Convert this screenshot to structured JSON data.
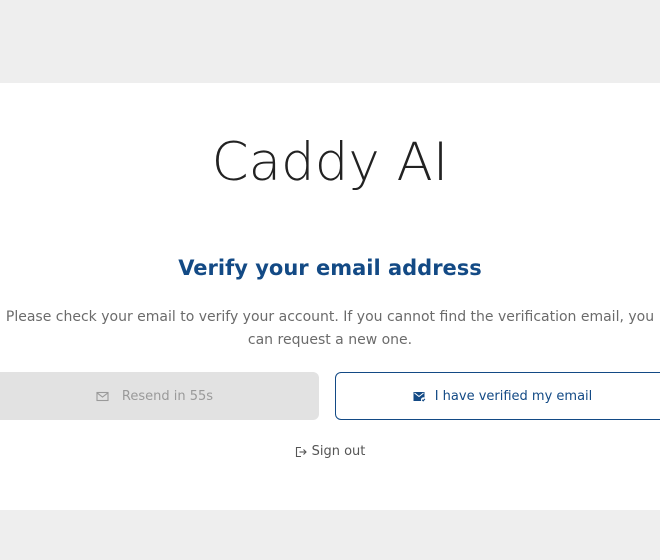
{
  "app": {
    "brand": "Caddy AI"
  },
  "verify": {
    "title": "Verify your email address",
    "message": "Please check your email to verify your account. If you cannot find the verification email, you can request a new one."
  },
  "actions": {
    "resend": {
      "label": "Resend in 55s",
      "icon": "mail-icon",
      "disabled": true
    },
    "verified": {
      "label": "I have verified my email",
      "icon": "mail-check-icon"
    },
    "signout": {
      "label": "Sign out",
      "icon": "sign-out-icon"
    }
  },
  "colors": {
    "accent": "#134a85",
    "page_bg": "#eeeeee",
    "card_bg": "#ffffff",
    "disabled_bg": "#e2e2e2"
  }
}
